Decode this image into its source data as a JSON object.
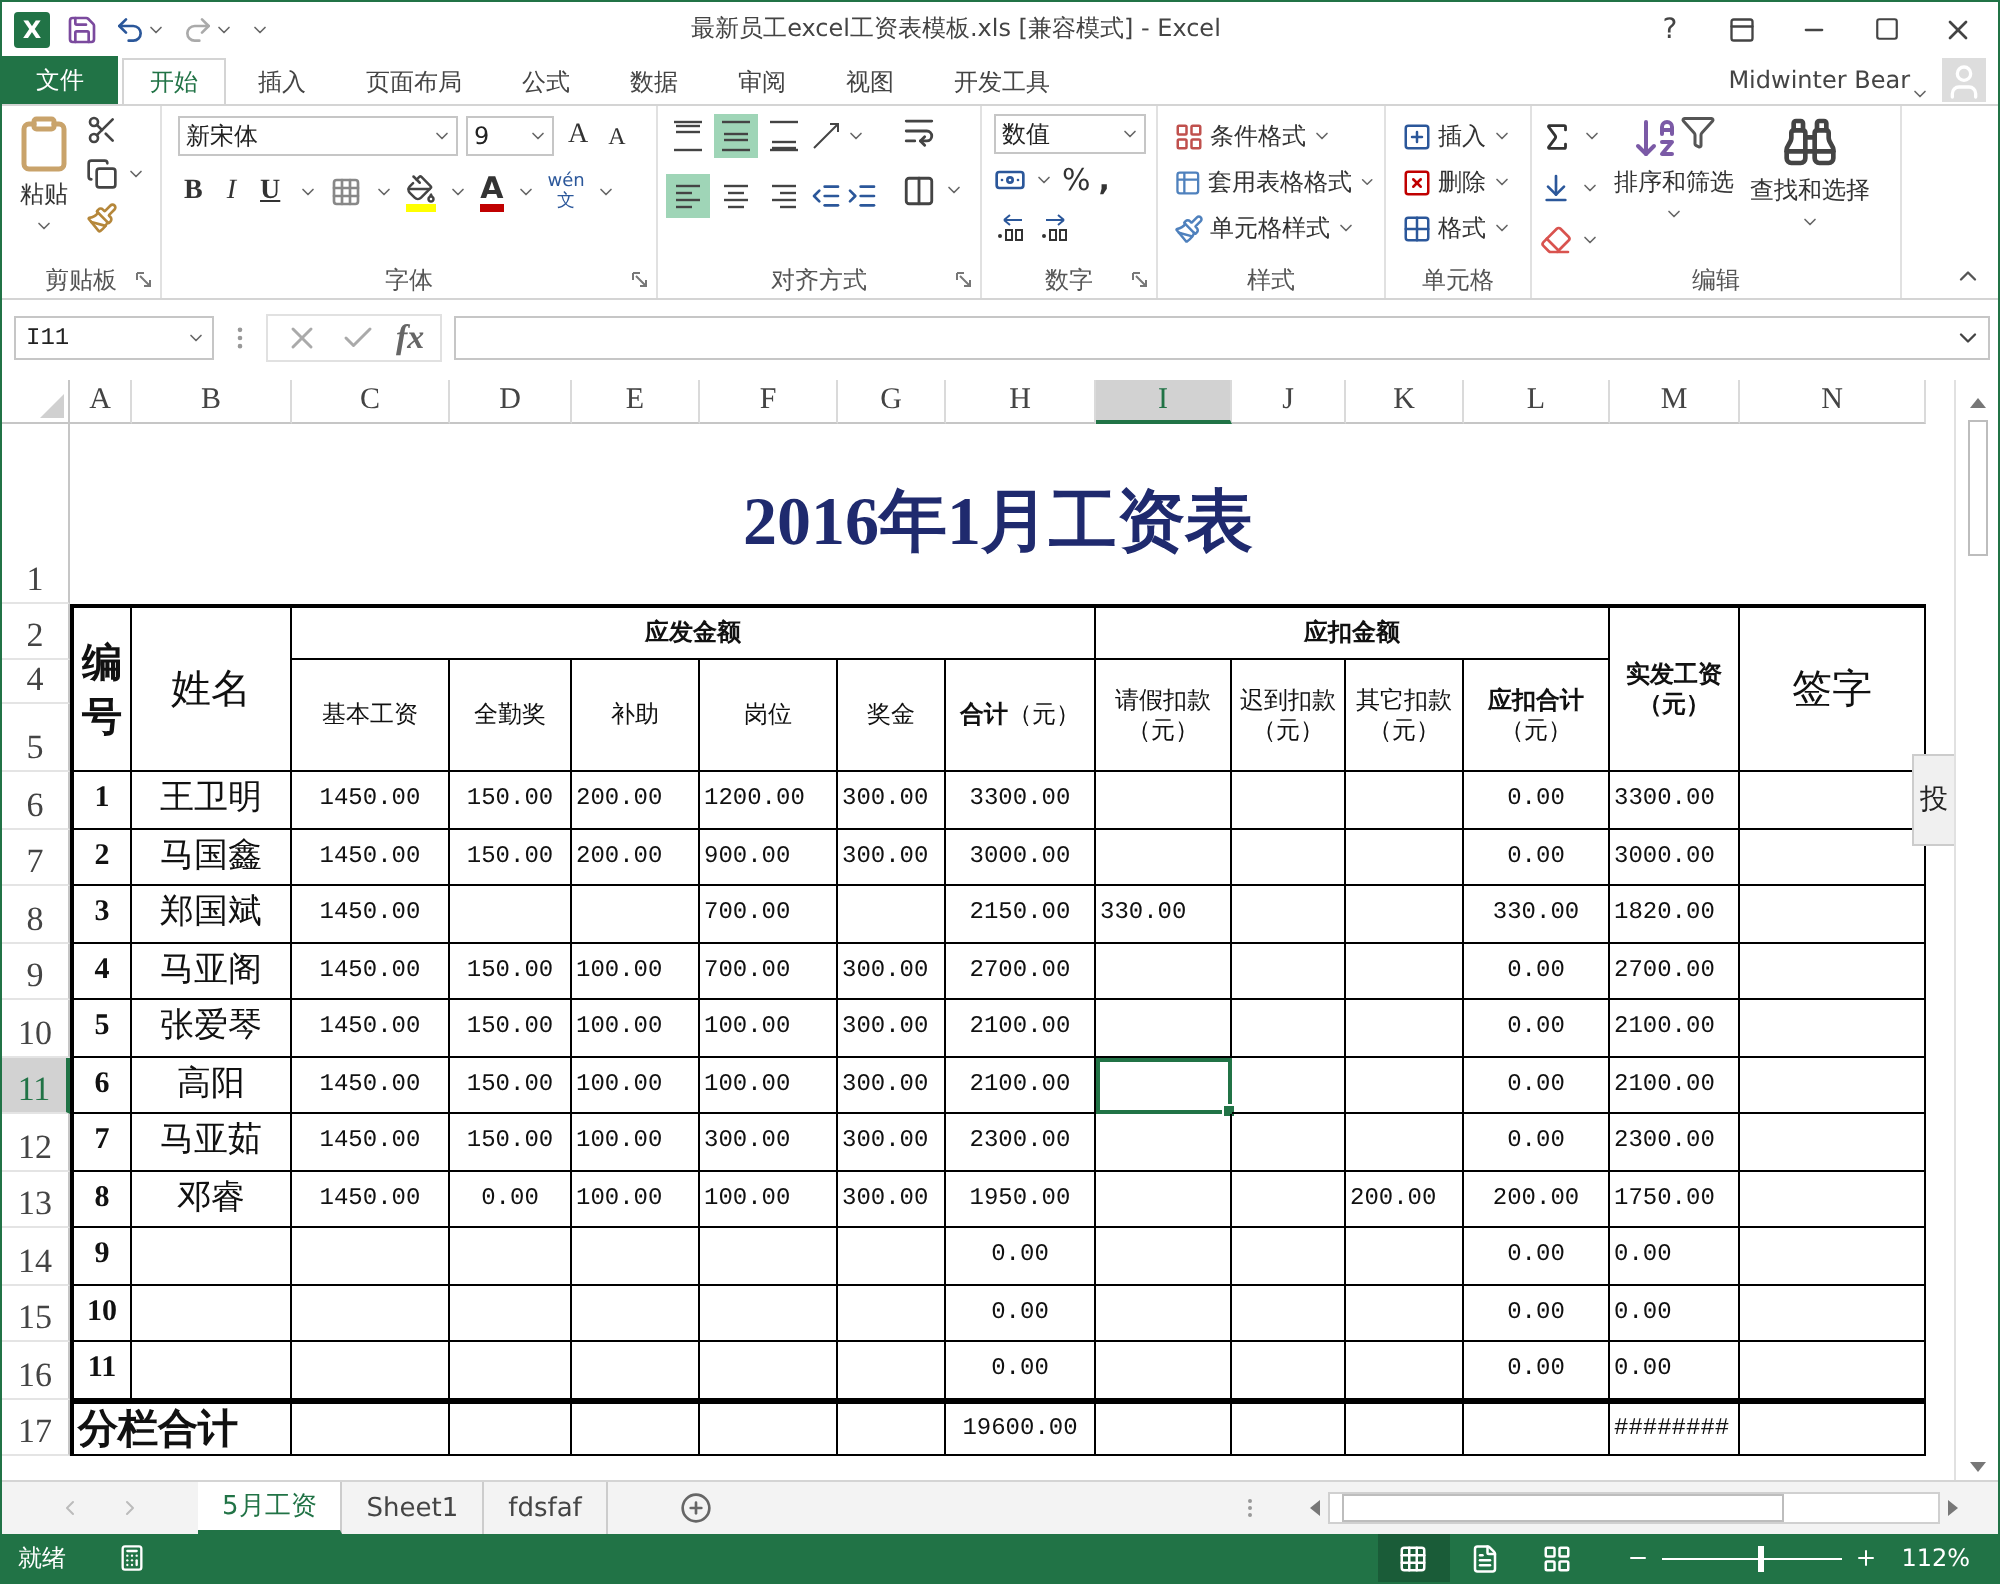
{
  "window": {
    "app_logo": "X",
    "title": "最新员工excel工资表模板.xls  [兼容模式] - Excel",
    "help": "?"
  },
  "user": {
    "name": "Midwinter Bear"
  },
  "tabs": [
    {
      "label": "文件",
      "kind": "file",
      "selected": false
    },
    {
      "label": "开始",
      "kind": "tab",
      "selected": true
    },
    {
      "label": "插入",
      "kind": "tab",
      "selected": false
    },
    {
      "label": "页面布局",
      "kind": "tab",
      "selected": false
    },
    {
      "label": "公式",
      "kind": "tab",
      "selected": false
    },
    {
      "label": "数据",
      "kind": "tab",
      "selected": false
    },
    {
      "label": "审阅",
      "kind": "tab",
      "selected": false
    },
    {
      "label": "视图",
      "kind": "tab",
      "selected": false
    },
    {
      "label": "开发工具",
      "kind": "tab",
      "selected": false
    }
  ],
  "ribbon": {
    "groups": [
      {
        "kind": "clipboard",
        "label": "剪贴板",
        "launcher": true,
        "paste": "粘贴"
      },
      {
        "kind": "font",
        "label": "字体",
        "launcher": true,
        "font": "新宋体",
        "size": "9",
        "grow": "A",
        "shrink": "A",
        "styles": [
          "B",
          "I",
          "U"
        ],
        "font_color": "A",
        "phonetic": [
          "wén",
          "文"
        ]
      },
      {
        "kind": "alignment",
        "label": "对齐方式",
        "launcher": true,
        "vertical": [
          {
            "selected": false
          },
          {
            "selected": true
          },
          {
            "selected": false
          }
        ],
        "horizontal": [
          {
            "selected": true
          },
          {
            "selected": false
          },
          {
            "selected": false
          }
        ]
      },
      {
        "kind": "number",
        "label": "数字",
        "launcher": true,
        "format": "数值",
        "percent": "%",
        "comma": ","
      },
      {
        "kind": "styles",
        "label": "样式",
        "items": [
          "条件格式",
          "套用表格格式",
          "单元格样式"
        ]
      },
      {
        "kind": "cells",
        "label": "单元格",
        "items": [
          "插入",
          "删除",
          "格式"
        ]
      },
      {
        "kind": "editing",
        "label": "编辑",
        "items": [
          "排序和筛选",
          "查找和选择"
        ]
      }
    ]
  },
  "formula_bar": {
    "name_box": "I11",
    "fx": "fx"
  },
  "sheet": {
    "columns": [
      {
        "label": "A",
        "selected": false
      },
      {
        "label": "B",
        "selected": false
      },
      {
        "label": "C",
        "selected": false
      },
      {
        "label": "D",
        "selected": false
      },
      {
        "label": "E",
        "selected": false
      },
      {
        "label": "F",
        "selected": false
      },
      {
        "label": "G",
        "selected": false
      },
      {
        "label": "H",
        "selected": false
      },
      {
        "label": "I",
        "selected": true
      },
      {
        "label": "J",
        "selected": false
      },
      {
        "label": "K",
        "selected": false
      },
      {
        "label": "L",
        "selected": false
      },
      {
        "label": "M",
        "selected": false
      },
      {
        "label": "N",
        "selected": false
      }
    ],
    "title_row": {
      "row": "1",
      "text": "2016年1月工资表"
    },
    "header_rows": [
      "2",
      "4",
      "5"
    ],
    "header": {
      "number": "编号",
      "name": "姓名",
      "gross_group": "应发金额",
      "gross_items": [
        "基本工资",
        "全勤奖",
        "补助",
        "岗位",
        "奖金",
        "**合计**（元）"
      ],
      "deduct_group": "应扣金额",
      "deduct_items": [
        "请假扣款（元）",
        "迟到扣款（元）",
        "其它扣款（元）",
        "**应扣合计**（元）"
      ],
      "net": "实发工资（元）",
      "sign": "签字"
    },
    "rows": [
      {
        "row": "6",
        "selected": false,
        "cells": [
          "1",
          "王卫明",
          "1450.00",
          "150.00",
          "200.00",
          "1200.00",
          "300.00",
          "3300.00",
          null,
          null,
          null,
          "0.00",
          "3300.00",
          null
        ]
      },
      {
        "row": "7",
        "selected": false,
        "cells": [
          "2",
          "马国鑫",
          "1450.00",
          "150.00",
          "200.00",
          "900.00",
          "300.00",
          "3000.00",
          null,
          null,
          null,
          "0.00",
          "3000.00",
          null
        ]
      },
      {
        "row": "8",
        "selected": false,
        "cells": [
          "3",
          "郑国斌",
          "1450.00",
          null,
          null,
          "700.00",
          null,
          "2150.00",
          "330.00",
          null,
          null,
          "330.00",
          "1820.00",
          null
        ]
      },
      {
        "row": "9",
        "selected": false,
        "cells": [
          "4",
          "马亚阁",
          "1450.00",
          "150.00",
          "100.00",
          "700.00",
          "300.00",
          "2700.00",
          null,
          null,
          null,
          "0.00",
          "2700.00",
          null
        ]
      },
      {
        "row": "10",
        "selected": false,
        "cells": [
          "5",
          "张爱琴",
          "1450.00",
          "150.00",
          "100.00",
          "100.00",
          "300.00",
          "2100.00",
          null,
          null,
          null,
          "0.00",
          "2100.00",
          null
        ]
      },
      {
        "row": "11",
        "selected": true,
        "cells": [
          "6",
          "高阳",
          "1450.00",
          "150.00",
          "100.00",
          "100.00",
          "300.00",
          "2100.00",
          null,
          null,
          null,
          "0.00",
          "2100.00",
          null
        ]
      },
      {
        "row": "12",
        "selected": false,
        "cells": [
          "7",
          "马亚茹",
          "1450.00",
          "150.00",
          "100.00",
          "300.00",
          "300.00",
          "2300.00",
          null,
          null,
          null,
          "0.00",
          "2300.00",
          null
        ]
      },
      {
        "row": "13",
        "selected": false,
        "cells": [
          "8",
          "邓睿",
          "1450.00",
          "0.00",
          "100.00",
          "100.00",
          "300.00",
          "1950.00",
          null,
          null,
          "200.00",
          "200.00",
          "1750.00",
          null
        ]
      },
      {
        "row": "14",
        "selected": false,
        "cells": [
          "9",
          null,
          null,
          null,
          null,
          null,
          null,
          "0.00",
          null,
          null,
          null,
          "0.00",
          "0.00",
          null
        ]
      },
      {
        "row": "15",
        "selected": false,
        "cells": [
          "10",
          null,
          null,
          null,
          null,
          null,
          null,
          "0.00",
          null,
          null,
          null,
          "0.00",
          "0.00",
          null
        ]
      },
      {
        "row": "16",
        "selected": false,
        "cells": [
          "11",
          null,
          null,
          null,
          null,
          null,
          null,
          "0.00",
          null,
          null,
          null,
          "0.00",
          "0.00",
          null
        ]
      }
    ],
    "total_row": {
      "row": "17",
      "selected": false,
      "label": "分栏合计",
      "cells": [
        null,
        null,
        null,
        null,
        null,
        "19600.00",
        null,
        null,
        null,
        null,
        "########",
        null
      ]
    }
  },
  "side_tab": {
    "label": "投"
  },
  "sheet_tabs": [
    {
      "label": "5月工资",
      "selected": true
    },
    {
      "label": "Sheet1",
      "selected": false
    },
    {
      "label": "fdsfaf",
      "selected": false
    }
  ],
  "status_bar": {
    "status": "就绪",
    "views": [
      {
        "selected": true
      },
      {
        "selected": false
      },
      {
        "selected": false
      }
    ],
    "zoom_slider": {
      "level": 0.55
    },
    "zoom": "112%"
  }
}
